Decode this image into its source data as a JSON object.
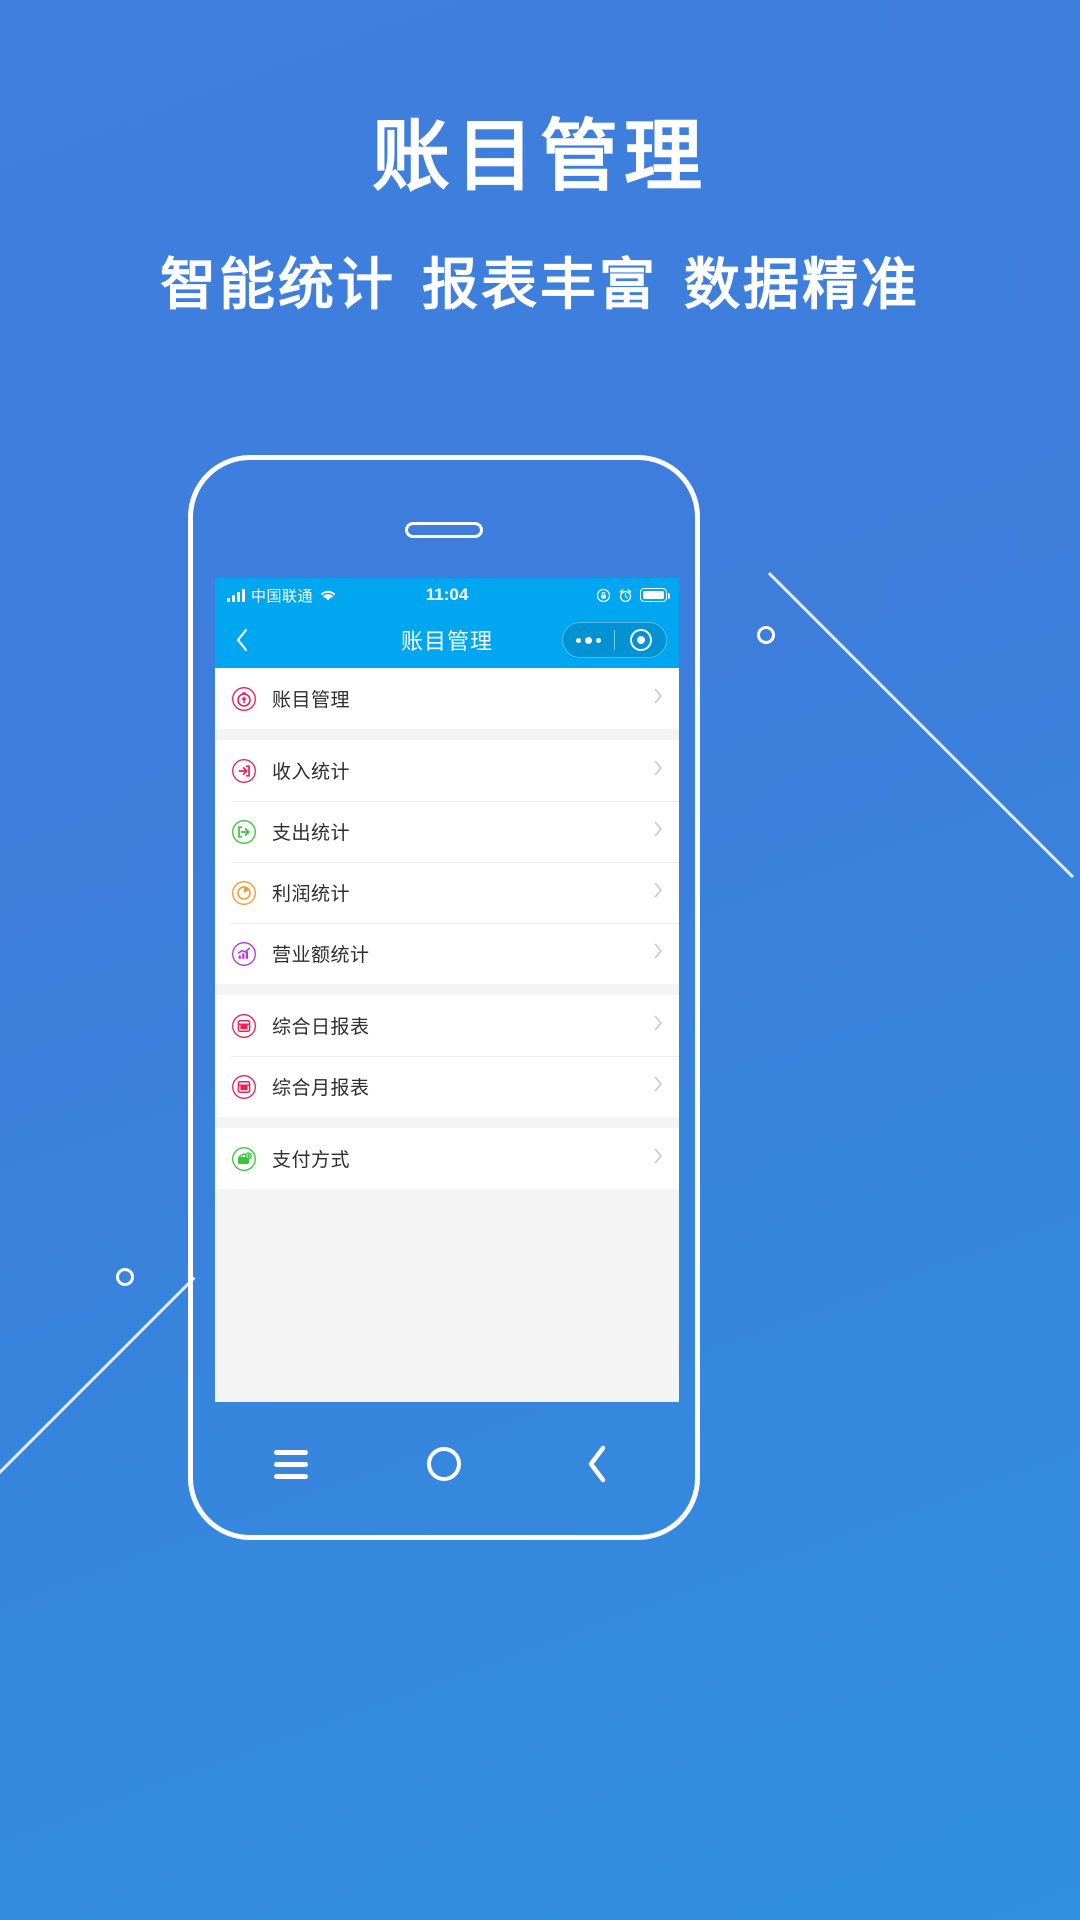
{
  "hero": {
    "title": "账目管理",
    "subtitle_parts": [
      "智能统计",
      "报表丰富",
      "数据精准"
    ]
  },
  "theme": {
    "background_blue": "#3f7fdd",
    "status_bar_blue": "#00a7f0",
    "nav_bar_blue": "#00a7f0",
    "android_nav_blue": "#3a9ae0",
    "white": "#ffffff",
    "list_bg": "#f4f4f4",
    "label_color": "#2e2e2e",
    "chevron_color": "#c8c8c8"
  },
  "phone": {
    "status_bar": {
      "carrier": "中国联通",
      "time": "11:04",
      "icons": [
        "signal-icon",
        "wifi-icon",
        "rotation-lock-icon",
        "alarm-icon",
        "battery-icon"
      ]
    },
    "nav_bar": {
      "back_icon": "chevron-left-icon",
      "title": "账目管理",
      "capsule": {
        "more_icon": "ellipsis-icon",
        "target_icon": "target-circle-icon"
      }
    },
    "list_groups": [
      {
        "items": [
          {
            "label": "账目管理",
            "icon": "coin-stopwatch-icon",
            "color": "#e8215a",
            "chevron": "chevron-right-icon"
          }
        ]
      },
      {
        "items": [
          {
            "label": "收入统计",
            "icon": "arrow-into-door-icon",
            "color": "#e8215a",
            "chevron": "chevron-right-icon"
          },
          {
            "label": "支出统计",
            "icon": "arrow-out-door-icon",
            "color": "#35c73a",
            "chevron": "chevron-right-icon"
          },
          {
            "label": "利润统计",
            "icon": "pie-chart-icon",
            "color": "#f29b2c",
            "chevron": "chevron-right-icon"
          },
          {
            "label": "营业额统计",
            "icon": "trend-chart-icon",
            "color": "#b935d6",
            "chevron": "chevron-right-icon"
          }
        ]
      },
      {
        "items": [
          {
            "label": "综合日报表",
            "icon": "calendar-report-icon",
            "color": "#e8215a",
            "chevron": "chevron-right-icon"
          },
          {
            "label": "综合月报表",
            "icon": "calendar-report-icon",
            "color": "#e8215a",
            "chevron": "chevron-right-icon"
          }
        ]
      },
      {
        "items": [
          {
            "label": "支付方式",
            "icon": "wallet-icon",
            "color": "#35c73a",
            "chevron": "chevron-right-icon"
          }
        ]
      }
    ],
    "android_nav": {
      "menu_icon": "hamburger-menu-icon",
      "home_icon": "home-circle-icon",
      "back_icon": "chevron-left-icon"
    }
  }
}
